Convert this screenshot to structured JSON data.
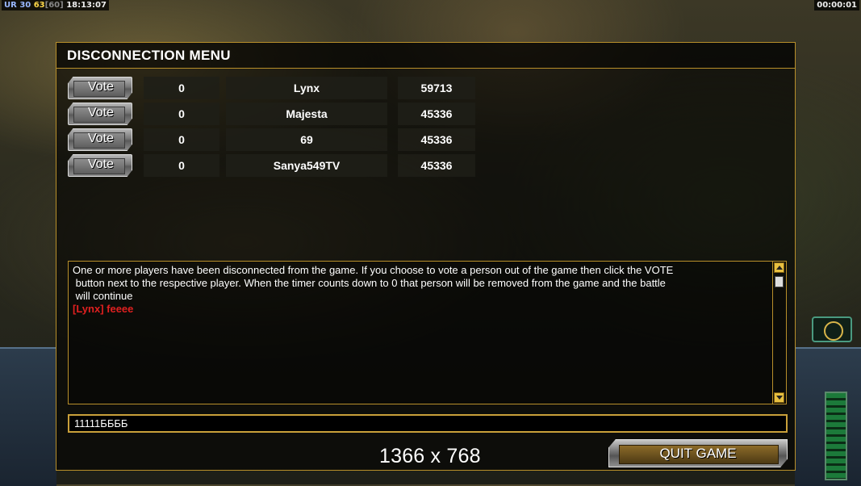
{
  "hud": {
    "overlay": {
      "ur": "UR",
      "ur_value": "30",
      "fps": "63",
      "fps_cap": "[60]",
      "clock": "18:13:07"
    },
    "game_timer": "00:00:01"
  },
  "dialog": {
    "title": "DISCONNECTION MENU",
    "players": [
      {
        "vote_label": "Vote",
        "votes": "0",
        "name": "Lynx",
        "ping": "59713"
      },
      {
        "vote_label": "Vote",
        "votes": "0",
        "name": "Majesta",
        "ping": "45336"
      },
      {
        "vote_label": "Vote",
        "votes": "0",
        "name": "69",
        "ping": "45336"
      },
      {
        "vote_label": "Vote",
        "votes": "0",
        "name": "Sanya549TV",
        "ping": "45336"
      }
    ],
    "messages": {
      "line1": "One or more players have been disconnected from the game. If you choose to vote a person out of the game then click the VOTE",
      "line2": " button next to the respective player. When the timer counts down to 0 that person will be removed from the game and the battle",
      "line3": " will continue",
      "chat": "[Lynx] feeee"
    },
    "chat_input_value": "11111ББББ",
    "resolution_label": "1366 x 768",
    "quit_label": "QUIT GAME"
  },
  "colors": {
    "accent_border": "#b88f2a",
    "chat_red": "#e02020",
    "fps_yellow": "#ffd94a"
  }
}
